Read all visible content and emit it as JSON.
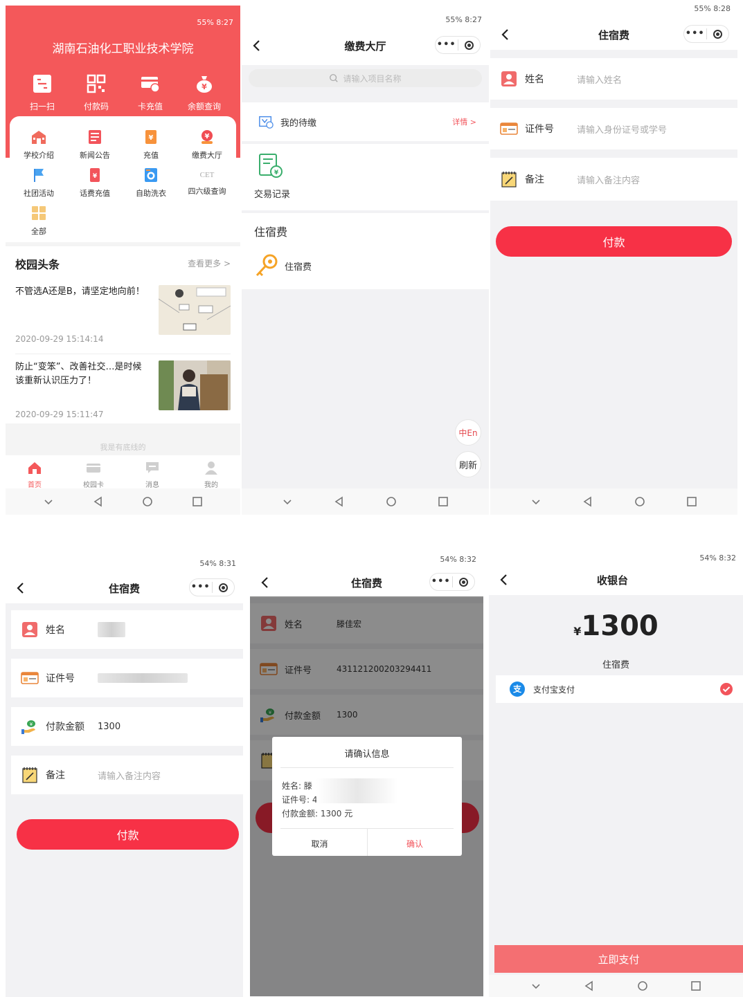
{
  "status": {
    "s1": "55%  8:27",
    "s2": "55%  8:27",
    "s3": "55%  8:28",
    "s4": "54%  8:31",
    "s5": "54%  8:32",
    "s6": "54%  8:32"
  },
  "home": {
    "school_title": "湖南石油化工职业技术学院",
    "top_actions": [
      {
        "label": "扫一扫",
        "icon": "scan-icon"
      },
      {
        "label": "付款码",
        "icon": "qr-code-icon"
      },
      {
        "label": "卡充值",
        "icon": "card-topup-icon"
      },
      {
        "label": "余额查询",
        "icon": "money-bag-icon"
      }
    ],
    "grid": [
      {
        "label": "学校介绍",
        "icon": "school-icon"
      },
      {
        "label": "新闻公告",
        "icon": "news-icon"
      },
      {
        "label": "充值",
        "icon": "recharge-icon"
      },
      {
        "label": "缴费大厅",
        "icon": "payment-hall-icon"
      },
      {
        "label": "社团活动",
        "icon": "flag-icon"
      },
      {
        "label": "话费充值",
        "icon": "phone-bill-icon"
      },
      {
        "label": "自助洗衣",
        "icon": "washing-machine-icon"
      },
      {
        "label": "四六级查询",
        "icon": "cet-icon"
      },
      {
        "label": "全部",
        "icon": "all-apps-icon"
      }
    ],
    "cet_mark": "CET",
    "headline_title": "校园头条",
    "see_more": "查看更多 >",
    "news": [
      {
        "title": "不管选A还是B，请坚定地向前！",
        "date": "2020-09-29 15:14:14"
      },
      {
        "title": "防止“变笨”、改善社交…是时候该重新认识压力了！",
        "date": "2020-09-29 15:11:47"
      }
    ],
    "bottom_line": "我是有底线的",
    "tabs": [
      {
        "label": "首页",
        "icon": "home-icon"
      },
      {
        "label": "校园卡",
        "icon": "campus-card-icon"
      },
      {
        "label": "消息",
        "icon": "message-icon"
      },
      {
        "label": "我的",
        "icon": "profile-icon"
      }
    ]
  },
  "hall": {
    "title": "缴费大厅",
    "search_placeholder": "请输入项目名称",
    "pending_label": "我的待缴",
    "pending_detail": "详情 >",
    "transactions_label": "交易记录",
    "section_title": "住宿费",
    "item_label": "住宿费",
    "lang_button": "中En",
    "refresh_button": "刷新"
  },
  "form": {
    "title": "住宿费",
    "name_label": "姓名",
    "name_placeholder": "请输入姓名",
    "id_label": "证件号",
    "id_placeholder": "请输入身份证号或学号",
    "remark_label": "备注",
    "remark_placeholder": "请输入备注内容",
    "pay_button": "付款"
  },
  "filled": {
    "title": "住宿费",
    "name_label": "姓名",
    "id_label": "证件号",
    "amount_label": "付款金额",
    "amount_value": "1300",
    "remark_label": "备注",
    "remark_placeholder": "请输入备注内容",
    "pay_button": "付款"
  },
  "confirm": {
    "title": "住宿费",
    "name_label": "姓名",
    "name_value": "滕佳宏",
    "id_label": "证件号",
    "id_value": "431121200203294411",
    "amount_label": "付款金额",
    "amount_value": "1300",
    "dialog_title": "请确认信息",
    "dialog_name": "姓名: 滕",
    "dialog_id": "证件号: 4",
    "dialog_amount": "付款金额: 1300 元",
    "cancel": "取消",
    "ok": "确认"
  },
  "cashier": {
    "title": "收银台",
    "currency": "¥",
    "amount": "1300",
    "item": "住宿费",
    "method": "支付宝支付",
    "alipay_mark": "支",
    "pay_now": "立即支付"
  }
}
